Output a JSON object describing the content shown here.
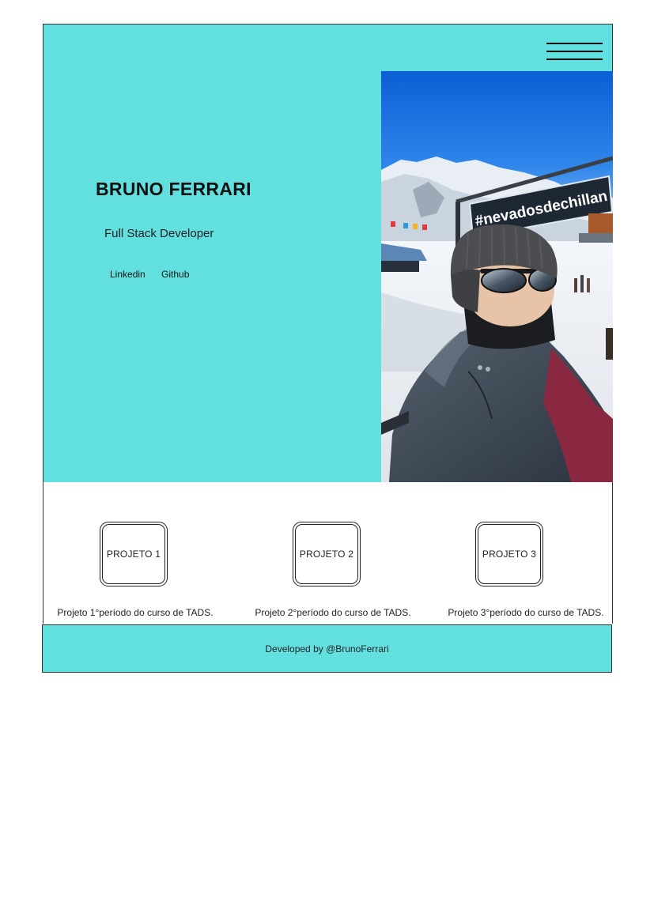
{
  "header": {
    "menu_icon": "hamburger-menu-icon"
  },
  "hero": {
    "name": "BRUNO FERRARI",
    "role": "Full Stack Developer",
    "links": [
      "Linkedin",
      "Github"
    ],
    "photo_sign_text": "#nevadosdechillan",
    "background_color": "#62e0df"
  },
  "projects": [
    {
      "label": "PROJETO 1",
      "description": "Projeto 1°período do curso de TADS."
    },
    {
      "label": "PROJETO 2",
      "description": "Projeto 2°período do curso de TADS."
    },
    {
      "label": "PROJETO 3",
      "description": "Projeto 3°período do curso de TADS."
    }
  ],
  "footer": {
    "text": "Developed by @BrunoFerrari"
  }
}
